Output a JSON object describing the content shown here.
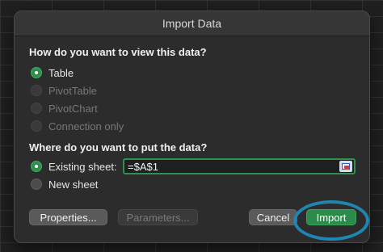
{
  "dialog": {
    "title": "Import Data",
    "view_heading": "How do you want to view this data?",
    "view_options": [
      {
        "label": "Table",
        "state": "selected"
      },
      {
        "label": "PivotTable",
        "state": "disabled"
      },
      {
        "label": "PivotChart",
        "state": "disabled"
      },
      {
        "label": "Connection only",
        "state": "disabled"
      }
    ],
    "location_heading": "Where do you want to put the data?",
    "location_options": [
      {
        "label": "Existing sheet:",
        "state": "selected"
      },
      {
        "label": "New sheet",
        "state": "unselected"
      }
    ],
    "reference_value": "=$A$1",
    "buttons": {
      "properties": "Properties...",
      "parameters": "Parameters...",
      "cancel": "Cancel",
      "import": "Import"
    }
  },
  "colors": {
    "accent": "#2c8a4b",
    "annotation_ring": "#1e86b0"
  },
  "icons": {
    "range_selector": "collapse-dialog-range-icon"
  }
}
